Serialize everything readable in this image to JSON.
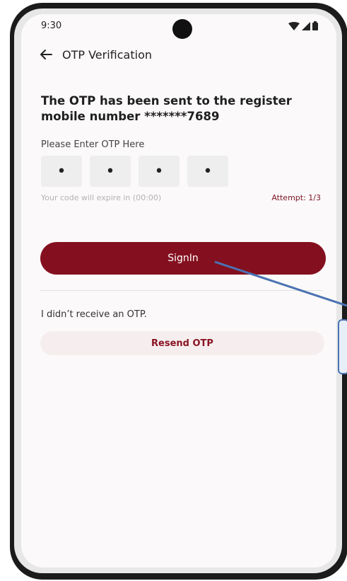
{
  "status_bar": {
    "time": "9:30",
    "icons": [
      "wifi-icon",
      "signal-icon",
      "battery-icon"
    ]
  },
  "header": {
    "title": "OTP Verification",
    "back_icon": "arrow-left-icon"
  },
  "message": {
    "text": "The OTP has been sent to the register mobile number *******7689"
  },
  "otp": {
    "label": "Please Enter OTP Here",
    "digits": [
      "•",
      "•",
      "•",
      "•"
    ],
    "expire_text": "Your code will expire in (00:00)",
    "attempt_text": "Attempt: 1/3"
  },
  "signin": {
    "label": "SignIn"
  },
  "resend": {
    "prompt": "I didn’t receive an OTP.",
    "label": "Resend OTP"
  },
  "colors": {
    "primary": "#84101f",
    "resend_bg": "#f6eeee",
    "annotation": "#4a72b3"
  }
}
